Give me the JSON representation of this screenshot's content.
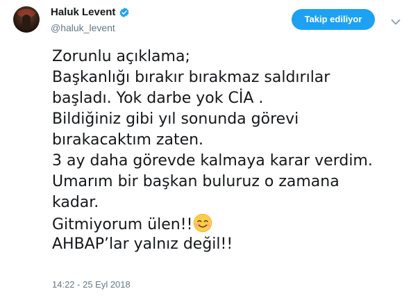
{
  "author": {
    "display_name": "Haluk Levent",
    "handle": "@haluk_levent",
    "verified": true
  },
  "follow_button": {
    "label": "Takip ediliyor"
  },
  "tweet": {
    "lines": [
      "Zorunlu açıklama;",
      "Başkanlığı bırakır bırakmaz saldırılar",
      "başladı. Yok darbe yok CİA .",
      "Bildiğiniz gibi yıl sonunda görevi",
      "bırakacaktım zaten.",
      "3 ay daha görevde kalmaya karar verdim.",
      "Umarım bir başkan buluruz o zamana",
      "kadar.",
      "Gitmiyorum ülen!!",
      "AHBAP’lar yalnız değil!!"
    ],
    "emoji": "smiling-face-with-smiling-eyes",
    "timestamp": "14:22 - 25 Eyl 2018"
  },
  "colors": {
    "accent": "#1da1f2",
    "text": "#14171a",
    "secondary_text": "#657786",
    "emoji_face": "#ffcc4d",
    "emoji_blush": "#f4a2a2"
  },
  "icons": {
    "verified": "verified-badge-icon",
    "more": "chevron-down-icon",
    "avatar": "avatar"
  }
}
